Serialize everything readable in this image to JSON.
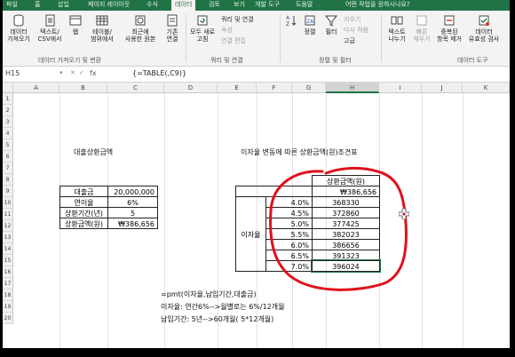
{
  "ribbon": {
    "tabs": [
      "파일",
      "홈",
      "삽입",
      "페이지 레이아웃",
      "수식",
      "데이터",
      "검토",
      "보기",
      "개발 도구",
      "도움말",
      "어떤 작업을 원하시나요?"
    ],
    "active_tab": "데이터",
    "buttons": {
      "get_data": "데이터\n가져오기",
      "from_text": "텍스트/\nCSV에서",
      "from_web": "웹",
      "from_table": "테이블/\n범위에서",
      "recent": "최근에\n사용한 원본",
      "existing": "기존\n연결",
      "refresh_all": "모두 새로\n고침",
      "sort": "정렬",
      "filter": "필터",
      "text_to_cols": "텍스트\n나누기",
      "flash_fill": "빠른\n채우기",
      "remove_dup": "중복된\n항목 제거",
      "validation": "데이터\n유효성 검사"
    },
    "small_items": {
      "queries": "쿼리 및 연결",
      "properties": "속성",
      "edit_links": "연결 편집",
      "clear": "지우기",
      "reapply": "다시 적용",
      "advanced": "고급"
    },
    "groups": {
      "get_transform": "데이터 가져오기 및 변환",
      "queries_connections": "쿼리 및 연결",
      "sort_filter": "정렬 및 필터",
      "data_tools": "데이터 도구"
    }
  },
  "formula_bar": {
    "name_box": "H15",
    "fx": "fx",
    "formula": "{=TABLE(,C9)}"
  },
  "columns": [
    "A",
    "B",
    "C",
    "D",
    "E",
    "F",
    "G",
    "H",
    "I",
    "J",
    "K"
  ],
  "selected_column": "H",
  "rows": [
    "1",
    "2",
    "3",
    "4",
    "5",
    "6",
    "7",
    "8",
    "9",
    "10",
    "11",
    "12",
    "13",
    "14",
    "15",
    "16",
    "17",
    "18",
    "19",
    "20"
  ],
  "sheet": {
    "title_left": "대출상환금액",
    "title_right": "이자율 변동에 따른 상환금액(원)조견표",
    "inputs": [
      {
        "label": "대출금",
        "value": "20,000,000"
      },
      {
        "label": "연이율",
        "value": "6%"
      },
      {
        "label": "상환기간(년)",
        "value": "5"
      },
      {
        "label": "상환금액(원)",
        "value": "₩386,656"
      }
    ],
    "table_header": "상환금액(원)",
    "table_top_value": "₩386,656",
    "rate_label": "이자율",
    "rates": [
      "4.0%",
      "4.5%",
      "5.0%",
      "5.5%",
      "6.0%",
      "6.5%",
      "7.0%"
    ],
    "payments": [
      "368330",
      "372860",
      "377425",
      "382023",
      "386656",
      "391323",
      "396024"
    ],
    "notes": [
      "=pmt(이자율,납입기간,대출금)",
      "이자율: 연간6%-->월별로는 6%/12개월",
      "납입기간: 5년-->60개월( 5*12개월)"
    ]
  },
  "colors": {
    "excel_green": "#217346",
    "annotation_red": "#e0101c"
  }
}
